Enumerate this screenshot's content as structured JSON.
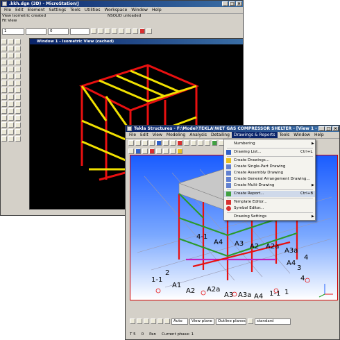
{
  "microstation": {
    "title": ".kkh.dgn (3D) - MicroStation/J",
    "menu": [
      "File",
      "Edit",
      "Element",
      "Settings",
      "Tools",
      "Utilities",
      "Workspace",
      "Window",
      "Help"
    ],
    "status_left_1": "View Isometric created",
    "status_left_2": "Fit View",
    "status_right": "NSOLID unloaded",
    "level_value": "1",
    "weight_value": "0",
    "view_title": "Window 1 - Isometric View (cached)"
  },
  "tekla": {
    "title": "Tekla Structures - F:\\Model\\TEKLA\\WET GAS COMPRESSOR SHELTER - [View 1 - 3d]",
    "menu": [
      "File",
      "Edit",
      "View",
      "Modeling",
      "Analysis",
      "Detailing",
      "Drawings & Reports",
      "Tools",
      "Window",
      "Help"
    ],
    "view_labels": [
      "4-1",
      "A4",
      "A3",
      "A2",
      "A2a",
      "A3a",
      "A1",
      "1-1",
      "2",
      "A2",
      "A2a",
      "A3",
      "A3a",
      "A4",
      "1-1",
      "1",
      "3",
      "4",
      "4",
      "A4"
    ],
    "bottom_controls": [
      "Auto",
      "View plane",
      "Outline planes",
      "standard"
    ],
    "status_values": [
      "T 5",
      "0",
      "Pan",
      "Current phase: 1"
    ]
  },
  "drawings_menu": {
    "items": [
      {
        "label": "Numbering",
        "shortcut": "",
        "submenu": true,
        "icon": "none"
      },
      {
        "label": "Drawing List...",
        "shortcut": "Ctrl+L",
        "submenu": false,
        "icon": "drawing-list-icon"
      },
      {
        "label": "Create Drawings...",
        "shortcut": "",
        "submenu": false,
        "icon": "create-drawings-icon"
      },
      {
        "label": "Create Single-Part Drawing",
        "shortcut": "",
        "submenu": false,
        "icon": "single-part-icon"
      },
      {
        "label": "Create Assembly Drawing",
        "shortcut": "",
        "submenu": false,
        "icon": "assembly-icon"
      },
      {
        "label": "Create General Arrangement Drawing...",
        "shortcut": "",
        "submenu": false,
        "icon": "ga-icon"
      },
      {
        "label": "Create Multi-Drawing",
        "shortcut": "",
        "submenu": true,
        "icon": "multi-drawing-icon"
      },
      {
        "label": "Create Report...",
        "shortcut": "Ctrl+B",
        "submenu": false,
        "icon": "report-icon"
      },
      {
        "label": "Template Editor...",
        "shortcut": "",
        "submenu": false,
        "icon": "template-icon"
      },
      {
        "label": "Symbol Editor...",
        "shortcut": "",
        "submenu": false,
        "icon": "symbol-icon"
      },
      {
        "label": "Drawing Settings",
        "shortcut": "",
        "submenu": true,
        "icon": "none"
      }
    ]
  },
  "colors": {
    "steel_red": "#e81010",
    "steel_yellow": "#f0e000",
    "brace_green": "#2a9a2a",
    "tekla_bg_top": "#1a5cff",
    "tekla_bg_bottom": "#ffffff"
  }
}
